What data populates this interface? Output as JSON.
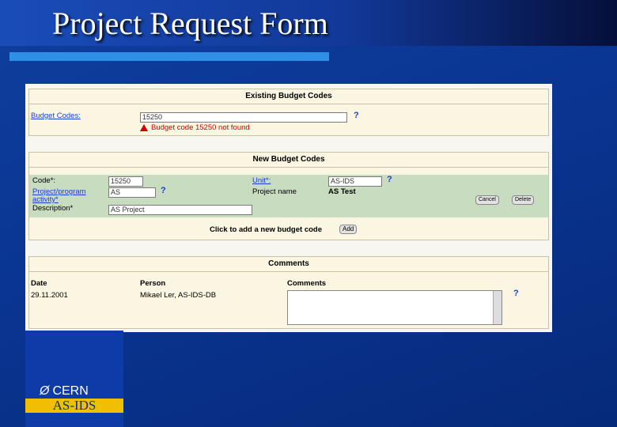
{
  "slide": {
    "title": "Project Request Form",
    "logo_text": "CERN",
    "footer_label": "AS-IDS"
  },
  "existing": {
    "header": "Existing Budget Codes",
    "budget_codes_label": "Budget Codes:",
    "budget_code_value": "15250",
    "help": "?",
    "error_message": "Budget code 15250 not found"
  },
  "new_codes": {
    "header": "New Budget Codes",
    "code_label": "Code*:",
    "code_value": "15250",
    "unit_label": "Unit*:",
    "unit_value": "AS-IDS",
    "project_activity_label_1": "Project/program",
    "project_activity_label_2": "activity*",
    "project_activity_value": "AS",
    "project_name_label": "Project name",
    "project_name_value": "AS Test",
    "description_label": "Description*",
    "description_value": "AS Project",
    "help": "?",
    "cancel_label": "Cancel",
    "delete_label": "Delete",
    "add_prompt": "Click to add a new budget code",
    "add_button": "Add"
  },
  "comments": {
    "header": "Comments",
    "col_date": "Date",
    "col_person": "Person",
    "col_comments": "Comments",
    "row_date": "29.11.2001",
    "row_person": "Mikael Ler, AS-IDS-DB",
    "help": "?"
  }
}
